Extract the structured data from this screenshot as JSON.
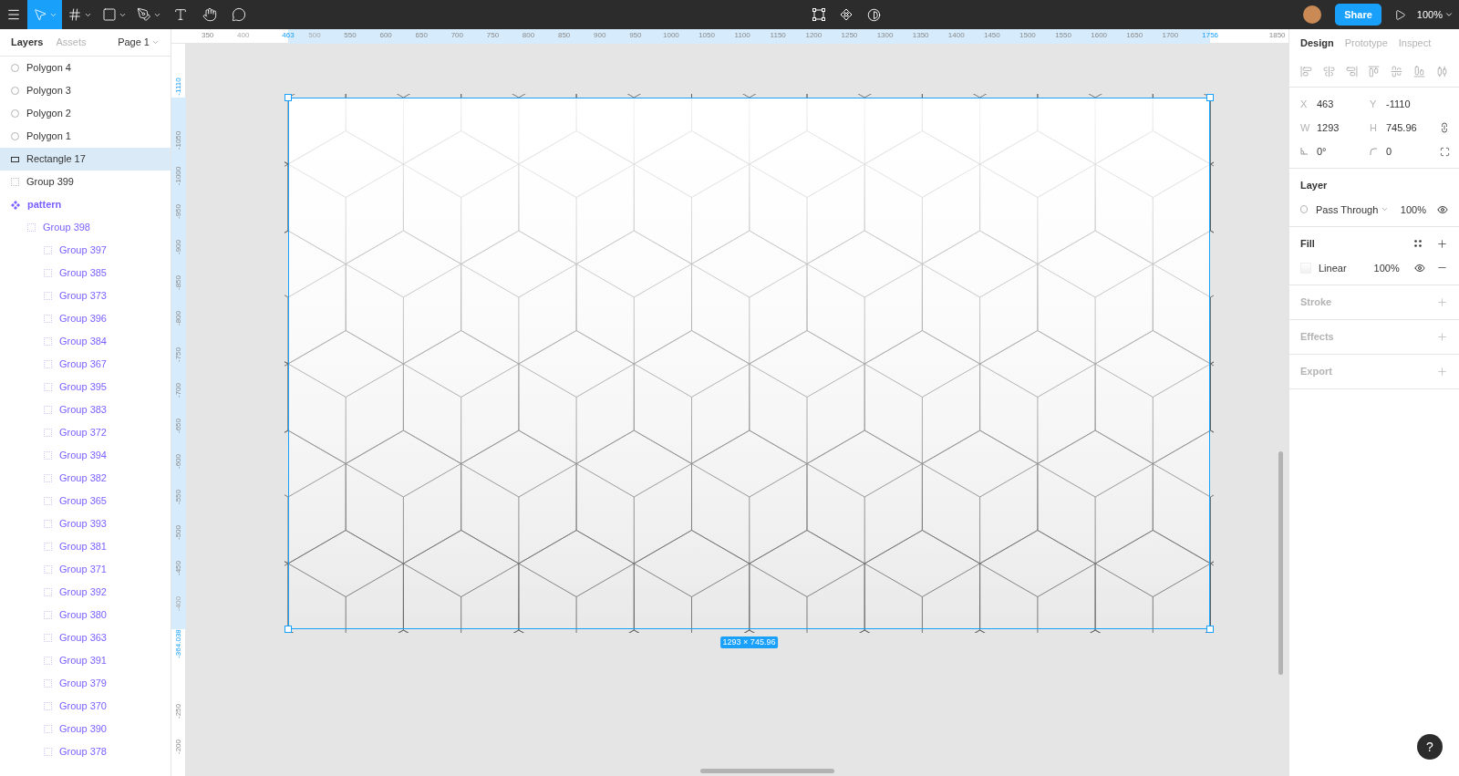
{
  "toolbar": {
    "tools": [
      {
        "kind": "move",
        "selected": true
      },
      {
        "kind": "frame",
        "selected": false
      },
      {
        "kind": "shape",
        "selected": false
      },
      {
        "kind": "pen",
        "selected": false
      },
      {
        "kind": "text",
        "selected": false
      },
      {
        "kind": "hand",
        "selected": false
      },
      {
        "kind": "comment",
        "selected": false
      }
    ],
    "share": "Share",
    "zoom": "100%"
  },
  "left_panel": {
    "tabs": [
      {
        "label": "Layers",
        "selected": true
      },
      {
        "label": "Assets",
        "selected": false
      }
    ],
    "page": "Page 1",
    "layers": [
      {
        "name": "Polygon 4",
        "kind": "polygon",
        "selected": false
      },
      {
        "name": "Polygon 3",
        "kind": "polygon",
        "selected": false
      },
      {
        "name": "Polygon 2",
        "kind": "polygon",
        "selected": false
      },
      {
        "name": "Polygon 1",
        "kind": "polygon",
        "selected": false
      },
      {
        "name": "Rectangle 17",
        "kind": "rectangle",
        "selected": true
      },
      {
        "name": "Group 399",
        "kind": "group",
        "selected": false
      },
      {
        "name": "pattern",
        "kind": "component",
        "selected": false,
        "children": [
          {
            "name": "Group 398",
            "kind": "group",
            "selected": false,
            "children": [
              {
                "name": "Group 397",
                "kind": "group",
                "selected": false
              },
              {
                "name": "Group 385",
                "kind": "group",
                "selected": false
              },
              {
                "name": "Group 373",
                "kind": "group",
                "selected": false
              },
              {
                "name": "Group 396",
                "kind": "group",
                "selected": false
              },
              {
                "name": "Group 384",
                "kind": "group",
                "selected": false
              },
              {
                "name": "Group 367",
                "kind": "group",
                "selected": false
              },
              {
                "name": "Group 395",
                "kind": "group",
                "selected": false
              },
              {
                "name": "Group 383",
                "kind": "group",
                "selected": false
              },
              {
                "name": "Group 372",
                "kind": "group",
                "selected": false
              },
              {
                "name": "Group 394",
                "kind": "group",
                "selected": false
              },
              {
                "name": "Group 382",
                "kind": "group",
                "selected": false
              },
              {
                "name": "Group 365",
                "kind": "group",
                "selected": false
              },
              {
                "name": "Group 393",
                "kind": "group",
                "selected": false
              },
              {
                "name": "Group 381",
                "kind": "group",
                "selected": false
              },
              {
                "name": "Group 371",
                "kind": "group",
                "selected": false
              },
              {
                "name": "Group 392",
                "kind": "group",
                "selected": false
              },
              {
                "name": "Group 380",
                "kind": "group",
                "selected": false
              },
              {
                "name": "Group 363",
                "kind": "group",
                "selected": false
              },
              {
                "name": "Group 391",
                "kind": "group",
                "selected": false
              },
              {
                "name": "Group 379",
                "kind": "group",
                "selected": false
              },
              {
                "name": "Group 370",
                "kind": "group",
                "selected": false
              },
              {
                "name": "Group 390",
                "kind": "group",
                "selected": false
              },
              {
                "name": "Group 378",
                "kind": "group",
                "selected": false
              }
            ]
          }
        ]
      }
    ]
  },
  "canvas": {
    "top_ruler": [
      {
        "label": "350",
        "kind": "tick"
      },
      {
        "label": "400",
        "kind": "faint"
      },
      {
        "label": "463",
        "kind": "marker"
      },
      {
        "label": "500",
        "kind": "faint"
      },
      {
        "label": "550",
        "kind": "tick"
      },
      {
        "label": "600",
        "kind": "tick"
      },
      {
        "label": "650",
        "kind": "tick"
      },
      {
        "label": "700",
        "kind": "tick"
      },
      {
        "label": "750",
        "kind": "tick"
      },
      {
        "label": "800",
        "kind": "tick"
      },
      {
        "label": "850",
        "kind": "tick"
      },
      {
        "label": "900",
        "kind": "tick"
      },
      {
        "label": "950",
        "kind": "tick"
      },
      {
        "label": "1000",
        "kind": "tick"
      },
      {
        "label": "1050",
        "kind": "tick"
      },
      {
        "label": "1100",
        "kind": "tick"
      },
      {
        "label": "1150",
        "kind": "tick"
      },
      {
        "label": "1200",
        "kind": "tick"
      },
      {
        "label": "1250",
        "kind": "tick"
      },
      {
        "label": "1300",
        "kind": "tick"
      },
      {
        "label": "1350",
        "kind": "tick"
      },
      {
        "label": "1400",
        "kind": "tick"
      },
      {
        "label": "1450",
        "kind": "tick"
      },
      {
        "label": "1500",
        "kind": "tick"
      },
      {
        "label": "1550",
        "kind": "tick"
      },
      {
        "label": "1600",
        "kind": "tick"
      },
      {
        "label": "1650",
        "kind": "tick"
      },
      {
        "label": "1700",
        "kind": "tick"
      },
      {
        "label": "1756",
        "kind": "marker"
      },
      {
        "label": "1850",
        "kind": "tick"
      }
    ],
    "left_ruler": [
      {
        "label": "-1110",
        "kind": "marker"
      },
      {
        "label": "-1050",
        "kind": "tick"
      },
      {
        "label": "-1000",
        "kind": "tick"
      },
      {
        "label": "-950",
        "kind": "tick"
      },
      {
        "label": "-900",
        "kind": "tick"
      },
      {
        "label": "-850",
        "kind": "tick"
      },
      {
        "label": "-800",
        "kind": "tick"
      },
      {
        "label": "-750",
        "kind": "tick"
      },
      {
        "label": "-700",
        "kind": "tick"
      },
      {
        "label": "-650",
        "kind": "tick"
      },
      {
        "label": "-600",
        "kind": "tick"
      },
      {
        "label": "-550",
        "kind": "tick"
      },
      {
        "label": "-500",
        "kind": "tick"
      },
      {
        "label": "-450",
        "kind": "tick"
      },
      {
        "label": "-400",
        "kind": "faint"
      },
      {
        "label": "-364.038",
        "kind": "marker"
      },
      {
        "label": "-250",
        "kind": "tick"
      },
      {
        "label": "-200",
        "kind": "tick"
      }
    ],
    "size_label": "1293 × 745.96",
    "help": "?"
  },
  "right_panel": {
    "tabs": [
      {
        "label": "Design",
        "selected": true
      },
      {
        "label": "Prototype",
        "selected": false
      },
      {
        "label": "Inspect",
        "selected": false
      }
    ],
    "geometry": [
      {
        "label": "X",
        "value": "463"
      },
      {
        "label": "Y",
        "value": "-1110"
      },
      {
        "label": "W",
        "value": "1293"
      },
      {
        "label": "H",
        "value": "745.96"
      }
    ],
    "rotation": "0°",
    "radius": "0",
    "layer": {
      "title": "Layer",
      "blend": "Pass Through",
      "opacity": "100%"
    },
    "fill": {
      "title": "Fill",
      "type": "Linear",
      "opacity": "100%"
    },
    "sections": [
      "Stroke",
      "Effects",
      "Export"
    ]
  }
}
